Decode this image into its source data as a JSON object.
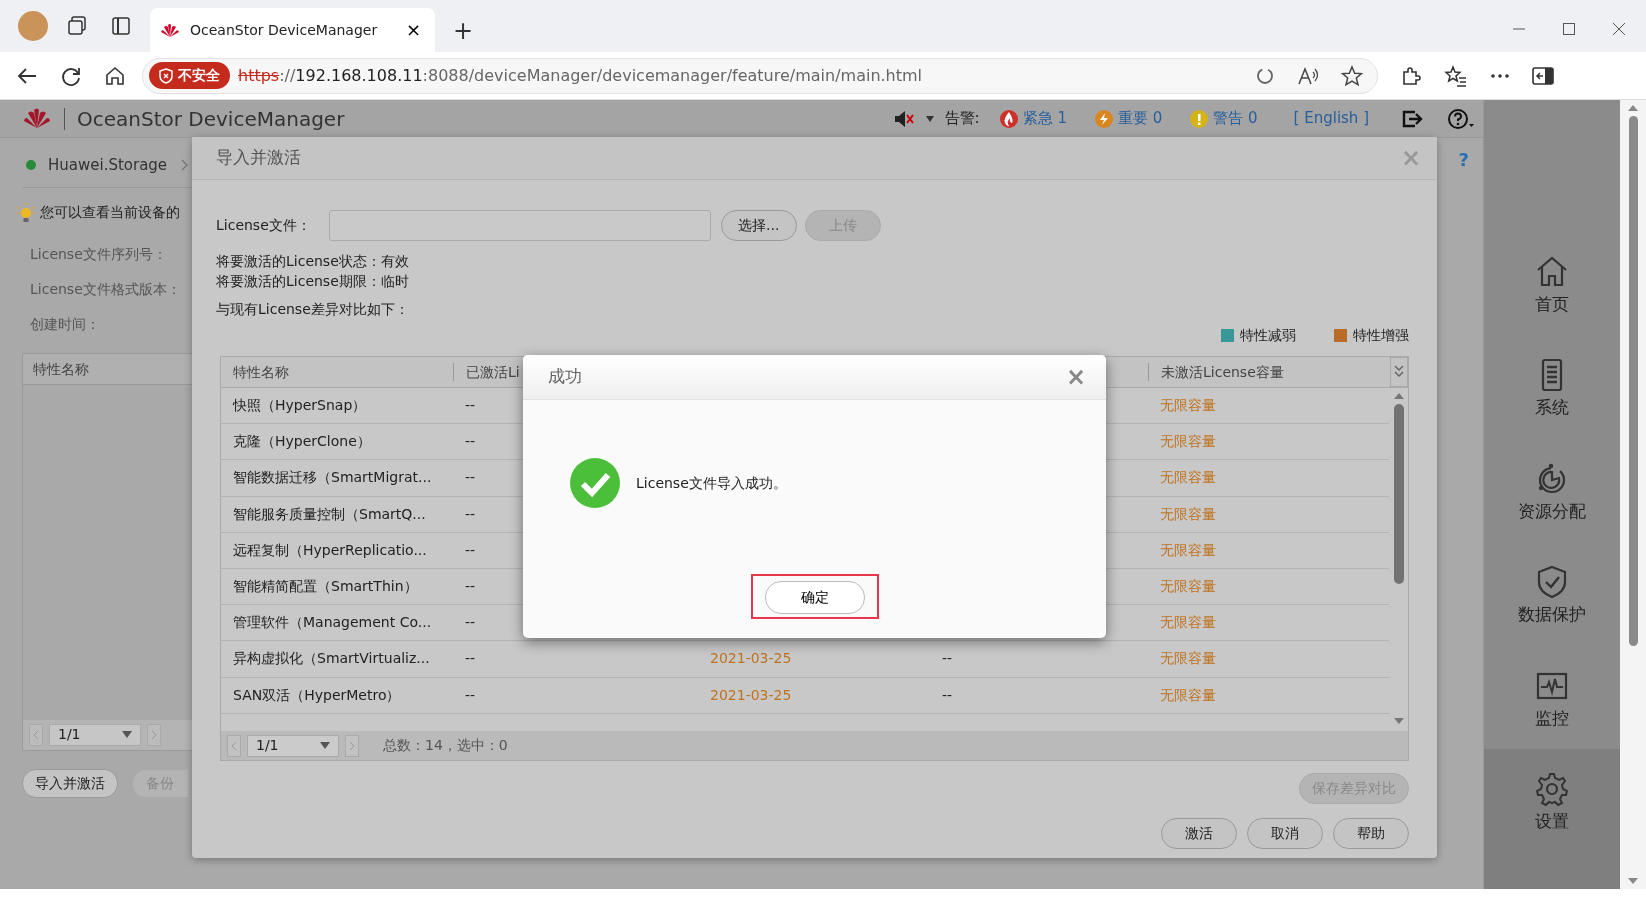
{
  "browser": {
    "tab": {
      "title": "OceanStor DeviceManager",
      "close": "×"
    },
    "new_tab": "+",
    "security_badge": "不安全",
    "url": {
      "scheme": "https",
      "separator": "://",
      "host": "192.168.108.11",
      "rest": ":8088/deviceManager/devicemanager/feature/main/main.html"
    }
  },
  "app_header": {
    "product": "OceanStor DeviceManager",
    "alarm_label": "告警:",
    "alarms": [
      {
        "kind": "critical",
        "label": "紧急 1"
      },
      {
        "kind": "major",
        "label": "重要 0"
      },
      {
        "kind": "warning",
        "label": "警告 0"
      }
    ],
    "language": "[ English ]"
  },
  "left_panel": {
    "device": "Huawei.Storage",
    "online": true,
    "hint": "您可以查看当前设备的",
    "fields": [
      "License文件序列号：",
      "License文件格式版本：",
      "创建时间："
    ],
    "table": {
      "columns": [
        "特性名称"
      ],
      "page": "1/1"
    },
    "buttons": [
      {
        "label": "导入并激活",
        "disabled": false
      },
      {
        "label": "备份",
        "disabled": true
      }
    ]
  },
  "help_link": "?",
  "dialog": {
    "title": "导入并激活",
    "close": "×",
    "file_label": "License文件：",
    "file_buttons": [
      {
        "label": "选择...",
        "disabled": false
      },
      {
        "label": "上传",
        "disabled": true
      }
    ],
    "info": [
      "将要激活的License状态：有效",
      "将要激活的License期限：临时"
    ],
    "compare_label": "与现有License差异对比如下：",
    "legend": [
      {
        "label": "特性减弱",
        "color": "#3a9797"
      },
      {
        "label": "特性增强",
        "color": "#b86c28"
      }
    ],
    "table": {
      "columns": [
        "特性名称",
        "已激活Li",
        null,
        null,
        "未激活License容量"
      ],
      "rows": [
        {
          "enhanced": true,
          "cells": [
            "快照（HyperSnap）",
            "--",
            null,
            null,
            "无限容量"
          ]
        },
        {
          "enhanced": true,
          "cells": [
            "克隆（HyperClone）",
            "--",
            null,
            null,
            "无限容量"
          ]
        },
        {
          "enhanced": true,
          "cells": [
            "智能数据迁移（SmartMigrat...",
            "--",
            null,
            null,
            "无限容量"
          ]
        },
        {
          "enhanced": true,
          "cells": [
            "智能服务质量控制（SmartQ...",
            "--",
            null,
            null,
            "无限容量"
          ]
        },
        {
          "enhanced": true,
          "cells": [
            "远程复制（HyperReplicatio...",
            "--",
            null,
            null,
            "无限容量"
          ]
        },
        {
          "enhanced": true,
          "cells": [
            "智能精简配置（SmartThin）",
            "--",
            null,
            null,
            "无限容量"
          ]
        },
        {
          "enhanced": true,
          "cells": [
            "管理软件（Management Co...",
            "--",
            null,
            null,
            "无限容量"
          ]
        },
        {
          "enhanced": true,
          "cells": [
            "异构虚拟化（SmartVirtualiz...",
            "--",
            "2021-03-25",
            "--",
            "无限容量"
          ]
        },
        {
          "enhanced": true,
          "cells": [
            "SAN双活（HyperMetro）",
            "--",
            "2021-03-25",
            "--",
            "无限容量"
          ]
        }
      ],
      "page": "1/1",
      "summary": "总数：14，选中：0"
    },
    "save_button": {
      "label": "保存差异对比",
      "disabled": true
    },
    "buttons": [
      {
        "label": "激活"
      },
      {
        "label": "取消"
      },
      {
        "label": "帮助"
      }
    ]
  },
  "success_modal": {
    "title": "成功",
    "close": "×",
    "message": "License文件导入成功。",
    "button": "确定",
    "highlighted": true
  },
  "nav": [
    {
      "kind": "home",
      "label": "首页",
      "in_footer": false
    },
    {
      "kind": "system",
      "label": "系统",
      "in_footer": false
    },
    {
      "kind": "resources",
      "label": "资源分配",
      "in_footer": false
    },
    {
      "kind": "protection",
      "label": "数据保护",
      "in_footer": false
    },
    {
      "kind": "monitor",
      "label": "监控",
      "in_footer": false
    },
    {
      "kind": "settings",
      "label": "设置",
      "in_footer": true
    }
  ]
}
